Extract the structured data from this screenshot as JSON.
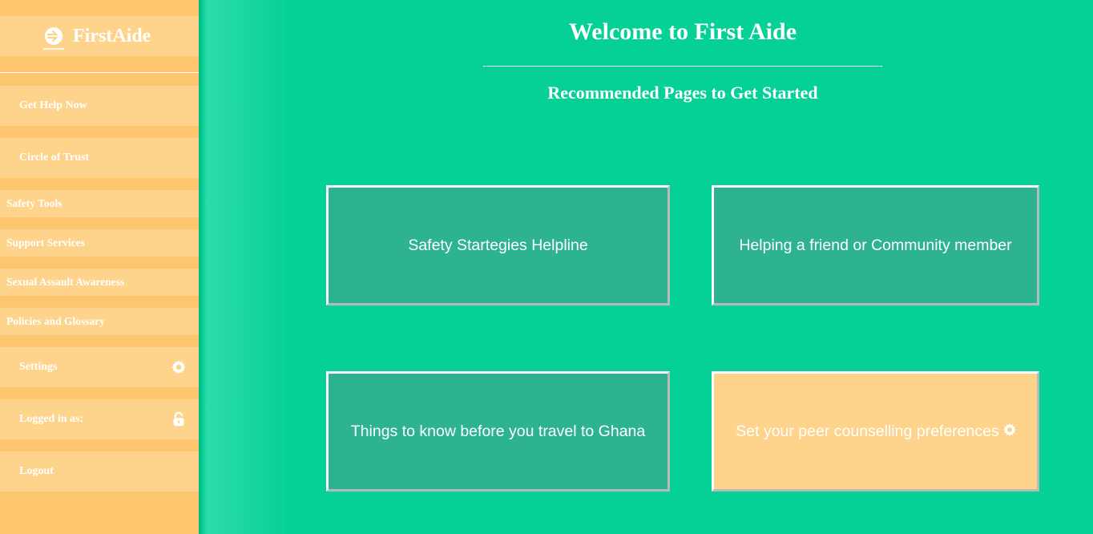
{
  "sidebar": {
    "brand": {
      "name": "FirstAide",
      "logo_icon": "firstaide-logo-icon"
    },
    "items": [
      {
        "label": "Get Help Now"
      },
      {
        "label": "Circle of Trust"
      },
      {
        "label": "Safety Tools"
      },
      {
        "label": "Support Services"
      },
      {
        "label": "Sexual Assault Awareness"
      },
      {
        "label": "Policies and Glossary"
      },
      {
        "label": "Settings",
        "icon": "gear-icon"
      },
      {
        "label": "Logged in as:",
        "icon": "lock-icon"
      },
      {
        "label": "Logout"
      }
    ]
  },
  "main": {
    "title": "Welcome to First Aide",
    "subtitle": "Recommended Pages to Get Started",
    "cards": [
      {
        "label": "Safety Startegies Helpline"
      },
      {
        "label": "Helping a friend or Community member"
      },
      {
        "label": "Things to know before you travel to Ghana"
      },
      {
        "label": "Set your peer counselling preferences",
        "icon": "gear-icon"
      }
    ]
  },
  "colors": {
    "background": "#05d196",
    "sidebar": "#fdc56e",
    "sidebar_item": "#fed38b",
    "card_green": "#2db38f",
    "card_peach": "#fed38b",
    "text": "#ffffff"
  }
}
